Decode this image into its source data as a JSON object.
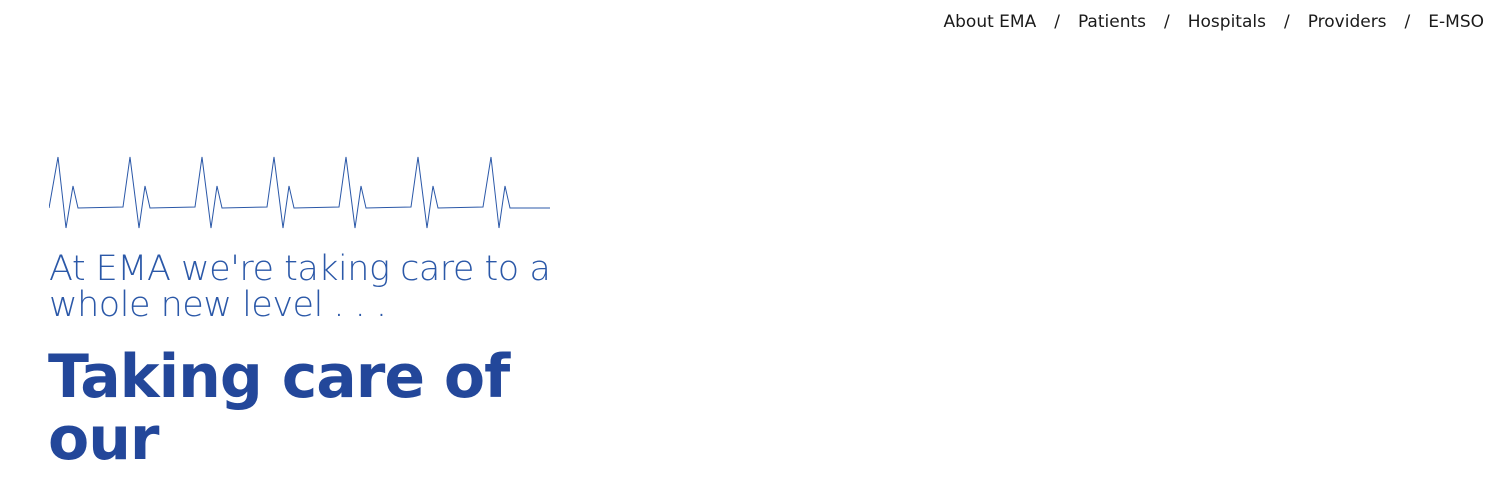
{
  "nav": {
    "items": [
      {
        "label": "About EMA"
      },
      {
        "label": "Patients"
      },
      {
        "label": "Hospitals"
      },
      {
        "label": "Providers"
      },
      {
        "label": "E-MSO"
      }
    ],
    "separator": "/"
  },
  "hero": {
    "tagline": "At EMA we're taking care to a whole new level . . .",
    "headline": "Taking care of our"
  },
  "colors": {
    "accent": "#2b58a8",
    "headline": "#23479a",
    "nav_text": "#1a1a1a"
  }
}
